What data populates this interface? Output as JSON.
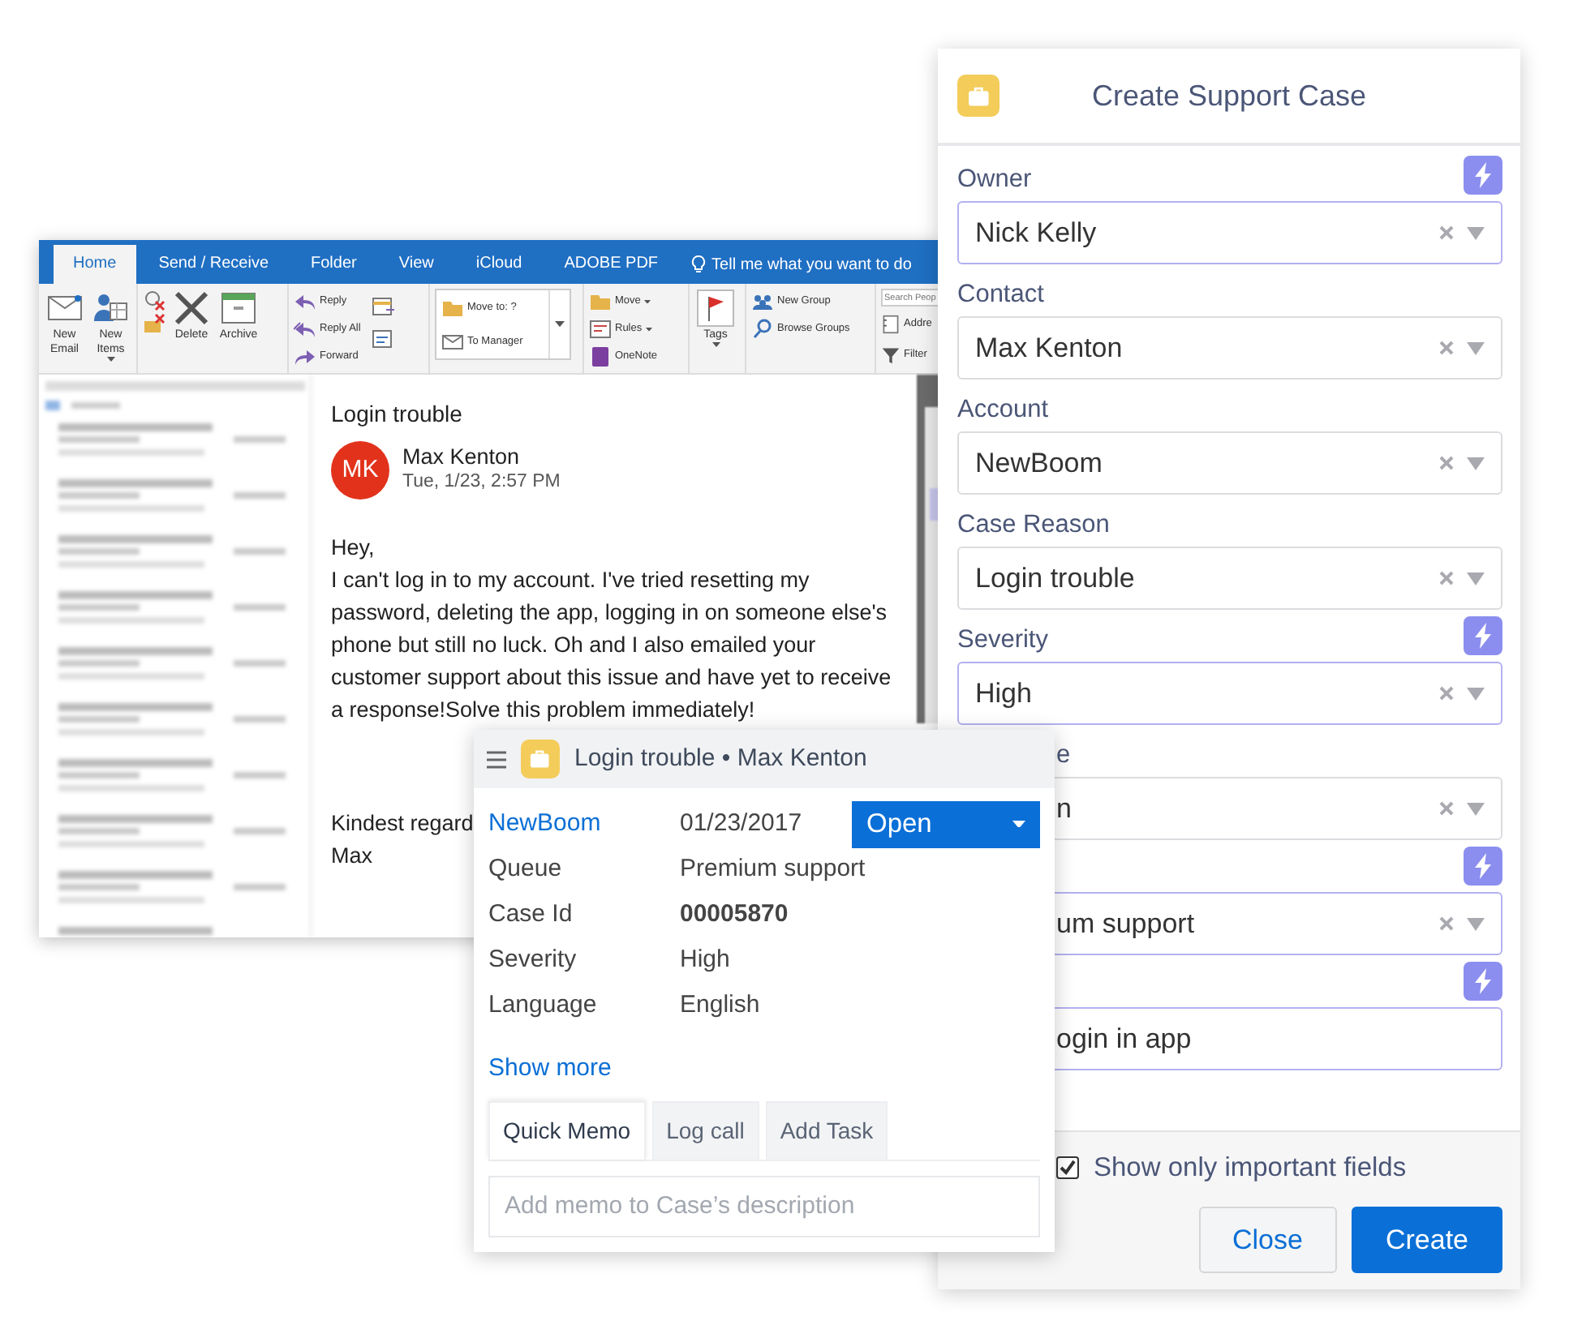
{
  "outlook": {
    "tabs": [
      {
        "label": "Home",
        "selected": true
      },
      {
        "label": "Send / Receive",
        "selected": false
      },
      {
        "label": "Folder",
        "selected": false
      },
      {
        "label": "View",
        "selected": false
      },
      {
        "label": "iCloud",
        "selected": false
      },
      {
        "label": "ADOBE PDF",
        "selected": false
      }
    ],
    "tell_me": "Tell me what you want to do",
    "ribbon_groups": [
      {
        "kind": "large",
        "items": [
          {
            "label": "New Email",
            "caret": false
          },
          {
            "label": "New Items",
            "caret": true
          }
        ]
      },
      {
        "kind": "large",
        "items": [
          {
            "label": "Delete",
            "caret": false
          },
          {
            "label": "Archive",
            "caret": false
          }
        ]
      },
      {
        "kind": "small",
        "items": [
          {
            "label": "Reply",
            "caret": false
          },
          {
            "label": "Reply All",
            "caret": false
          },
          {
            "label": "Forward",
            "caret": false
          }
        ]
      },
      {
        "kind": "quick",
        "items": [
          {
            "label": "Move to: ?",
            "caret": false
          },
          {
            "label": "To Manager",
            "caret": false
          }
        ]
      },
      {
        "kind": "small",
        "items": [
          {
            "label": "Move",
            "caret": true
          },
          {
            "label": "Rules",
            "caret": true
          },
          {
            "label": "OneNote",
            "caret": false
          }
        ]
      },
      {
        "kind": "large",
        "items": [
          {
            "label": "Tags",
            "caret": true
          }
        ]
      },
      {
        "kind": "small",
        "items": [
          {
            "label": "New Group",
            "caret": false
          },
          {
            "label": "Browse Groups",
            "caret": false
          }
        ]
      },
      {
        "kind": "search",
        "placeholder": "Search Peop",
        "items": [
          {
            "label": "Addre",
            "caret": false
          },
          {
            "label": "Filter",
            "caret": false
          }
        ]
      }
    ],
    "email": {
      "subject": "Login trouble",
      "avatar": "MK",
      "sender": "Max Kenton",
      "date": "Tue, 1/23, 2:57 PM",
      "blocks": [
        [
          "Hey,",
          "I can't log in to my account. I've tried resetting my password, deleting the app, logging in on someone else's phone but still no luck. Oh and I also emailed your customer support about this issue and have yet to receive a response!Solve this problem immediately!"
        ],
        [
          "Kindest regard",
          "Max"
        ]
      ]
    }
  },
  "case_popup": {
    "title": "Login trouble • Max Kenton",
    "account": "NewBoom",
    "date": "01/23/2017",
    "status": "Open",
    "details": [
      {
        "label": "Queue",
        "value": "Premium support",
        "bold": false
      },
      {
        "label": "Case Id",
        "value": "00005870",
        "bold": true
      },
      {
        "label": "Severity",
        "value": "High",
        "bold": false
      },
      {
        "label": "Language",
        "value": "English",
        "bold": false
      }
    ],
    "show_more": "Show more",
    "tabs": [
      {
        "label": "Quick Memo",
        "selected": true
      },
      {
        "label": "Log call",
        "selected": false
      },
      {
        "label": "Add Task",
        "selected": false
      }
    ],
    "memo": {
      "placeholder": "Add memo to Case’s description"
    }
  },
  "create_case": {
    "title": "Create Support Case",
    "fields": [
      {
        "label": "Owner",
        "value": "Nick Kelly",
        "kind": "select",
        "important": true
      },
      {
        "label": "Contact",
        "value": "Max Kenton",
        "kind": "select",
        "important": false
      },
      {
        "label": "Account",
        "value": "NewBoom",
        "kind": "select",
        "important": false
      },
      {
        "label": "Case Reason",
        "value": "Login trouble",
        "kind": "select",
        "important": false
      },
      {
        "label": "Severity",
        "value": "High",
        "kind": "select",
        "important": true
      },
      {
        "label": "e",
        "value": "n",
        "kind": "select",
        "important": false
      },
      {
        "value": "um support",
        "kind": "select",
        "important": true
      },
      {
        "value": "ogin in app",
        "kind": "text",
        "important": true
      }
    ],
    "important_only": {
      "label": "Show only important fields",
      "checked": true
    },
    "buttons": [
      {
        "label": "Close",
        "kind": "secondary"
      },
      {
        "label": "Create",
        "kind": "primary"
      }
    ]
  }
}
